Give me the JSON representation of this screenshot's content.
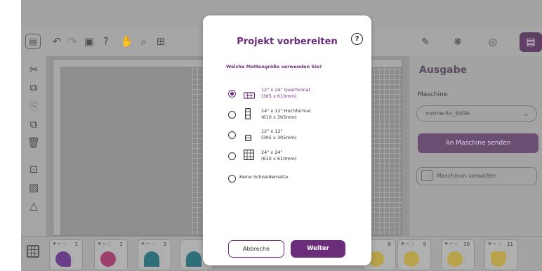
{
  "modal": {
    "title": "Projekt vorbereiten",
    "help_icon": "?",
    "question": "Welche Mattengröße verwenden Sie?",
    "options": [
      {
        "line1": "12\" x 24\" Querformat",
        "line2": "(305 x 610mm)",
        "selected": true,
        "icon": "landscape-mat-icon"
      },
      {
        "line1": "24\" x 12\" Hochformat",
        "line2": "(610 x 305mm)",
        "selected": false,
        "icon": "portrait-mat-icon"
      },
      {
        "line1": "12\" x 12\"",
        "line2": "(305 x 305mm)",
        "selected": false,
        "icon": "square-small-mat-icon"
      },
      {
        "line1": "24\" x 24\"",
        "line2": "(610 x 610mm)",
        "selected": false,
        "icon": "square-large-mat-icon"
      },
      {
        "line1": "Keine Schneidematte",
        "line2": "",
        "selected": false,
        "icon": ""
      }
    ],
    "cancel_label": "Abbreche",
    "next_label": "Weiter"
  },
  "right_panel": {
    "title": "Ausgabe",
    "machine_label": "Maschine",
    "machine_value": "momento_649b",
    "send_label": "An Maschine senden",
    "manage_label": "Maschinen verwalten"
  },
  "layers": [
    {
      "num": "1",
      "color": "#6a3f8a"
    },
    {
      "num": "2",
      "color": "#9c3f6a"
    },
    {
      "num": "3",
      "color": "#2f6f7a"
    },
    {
      "num": "8",
      "color": "#b8a24a"
    },
    {
      "num": "9",
      "color": "#b8a24a"
    },
    {
      "num": "10",
      "color": "#b8a24a"
    },
    {
      "num": "11",
      "color": "#b8a24a"
    }
  ],
  "colors": {
    "accent": "#6b2d7a",
    "overlay": "#9a9a9a"
  }
}
